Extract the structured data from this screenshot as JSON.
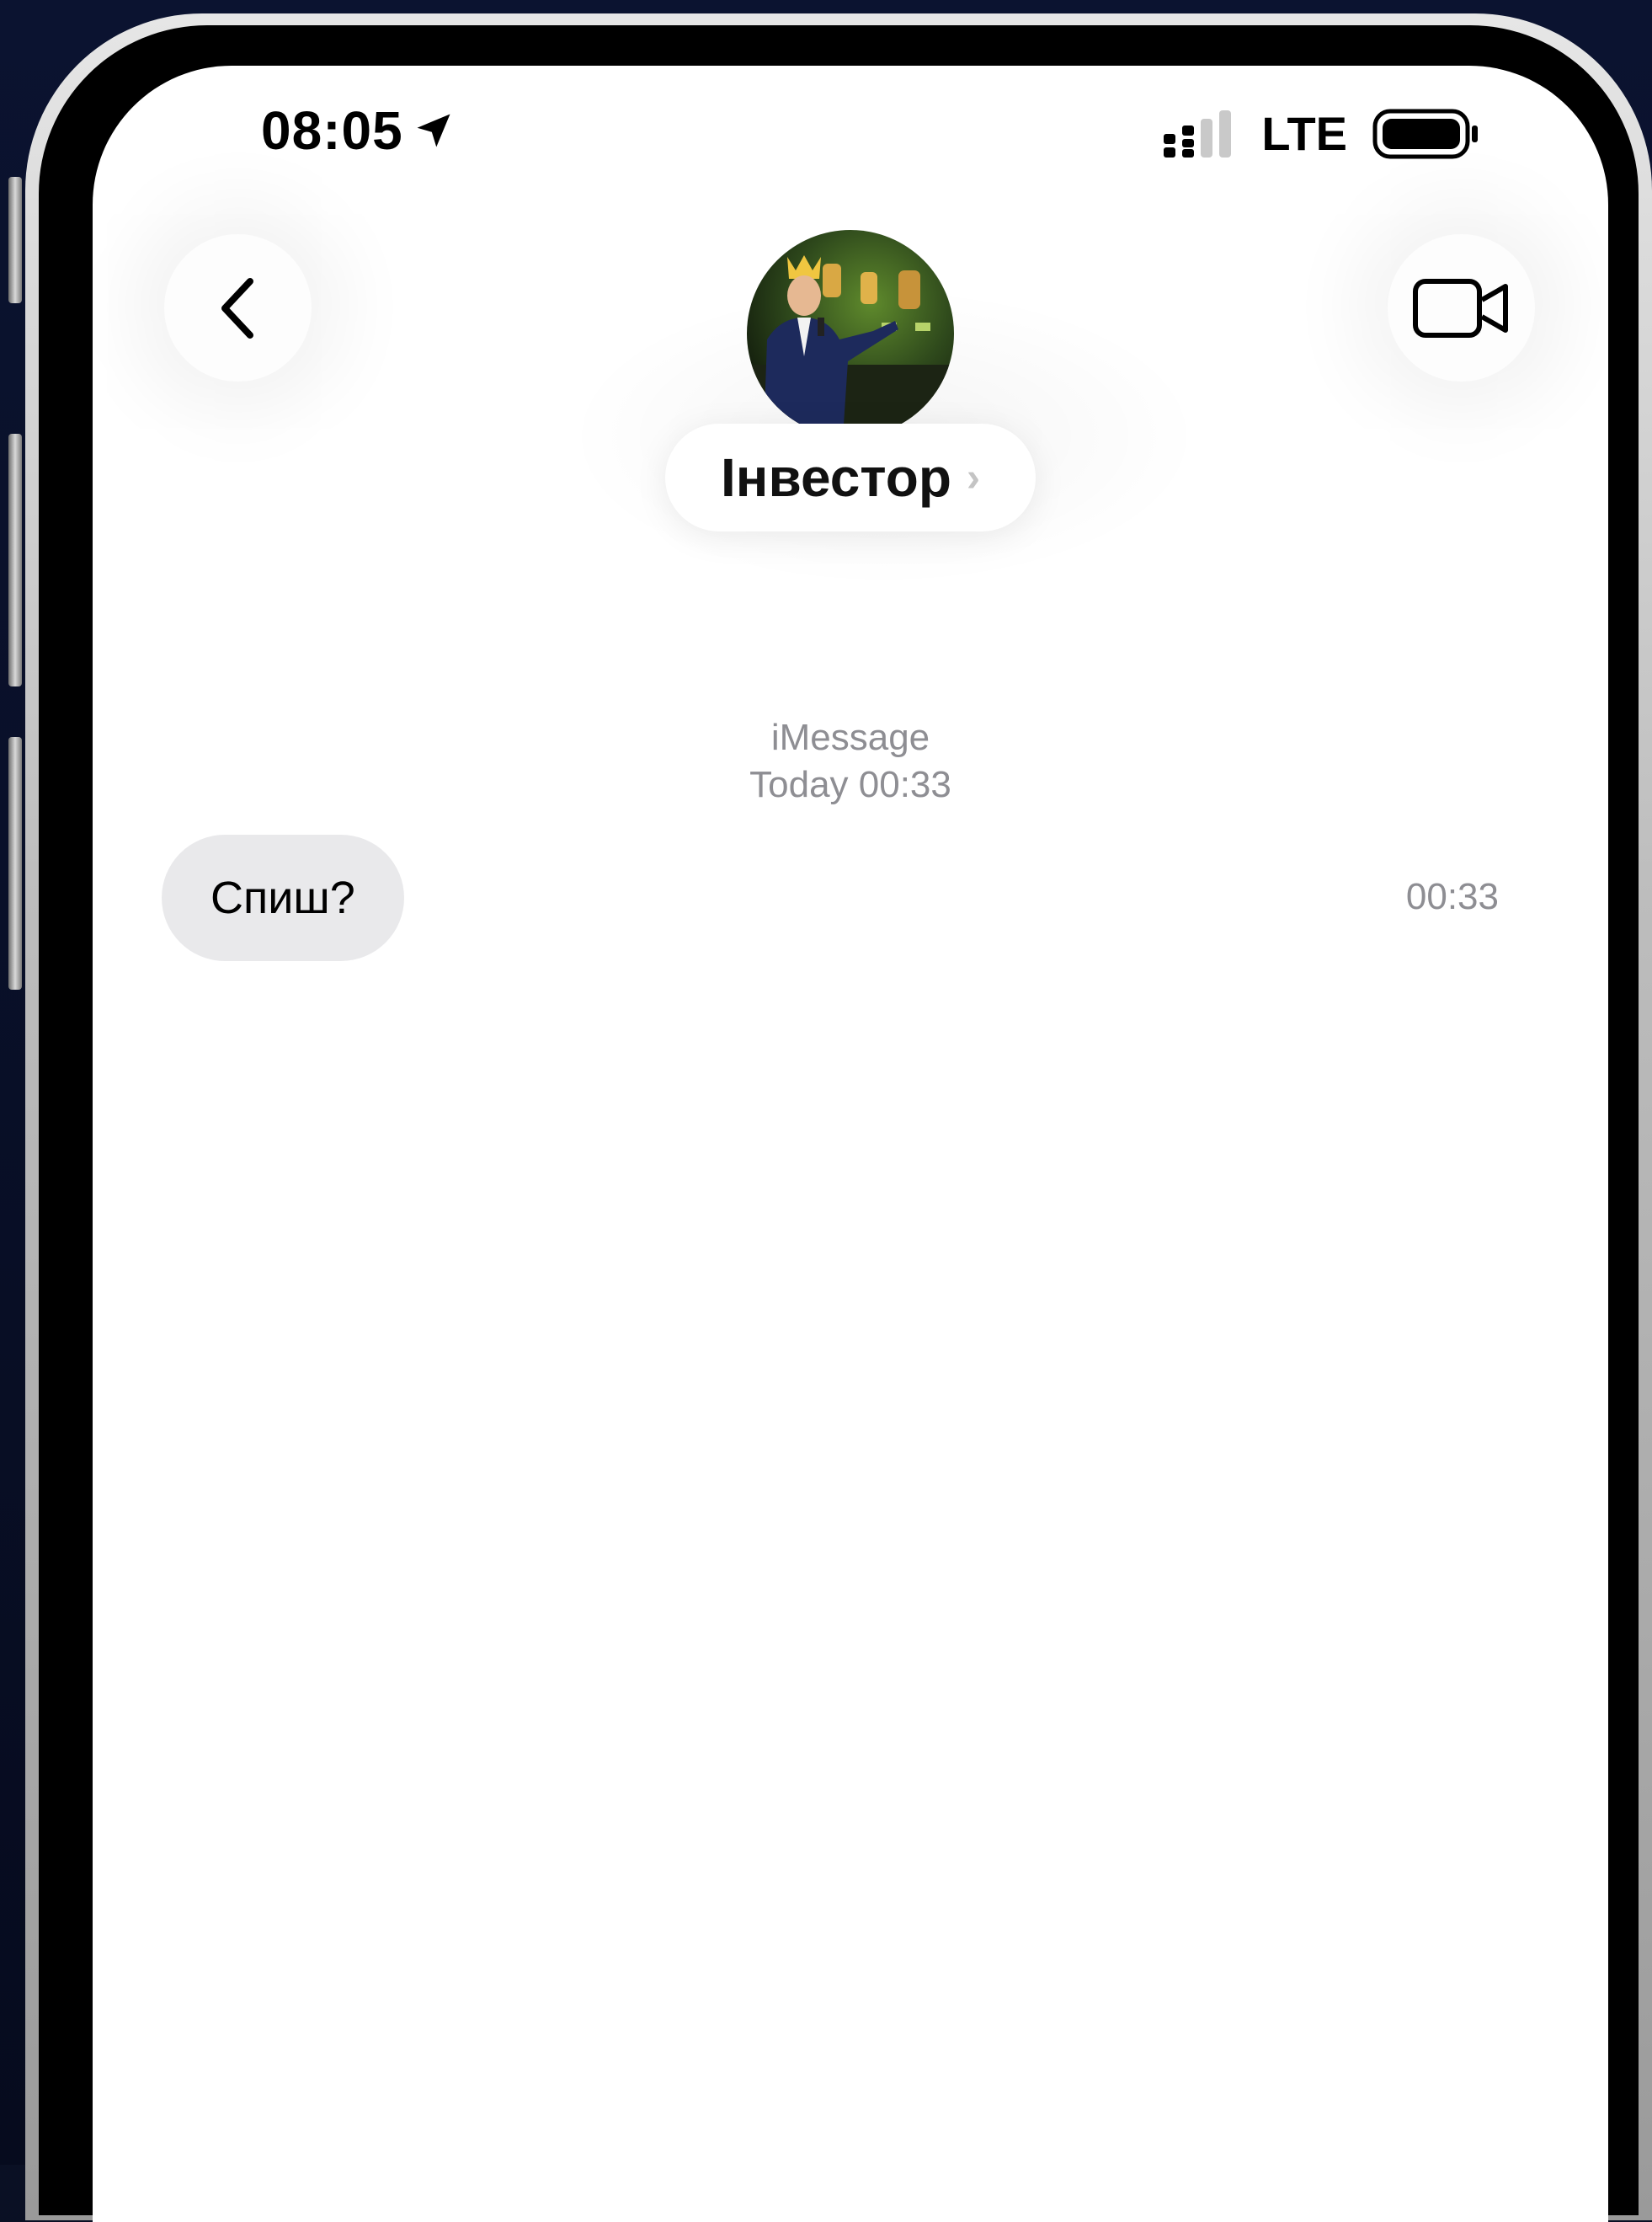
{
  "status_bar": {
    "time": "08:05",
    "network": "LTE",
    "location_icon": "location-arrow-icon",
    "signal_icon": "signal-icon",
    "battery_icon": "battery-icon"
  },
  "header": {
    "back_icon": "chevron-left-icon",
    "contact_name": "Інвестор",
    "contact_chevron": "›",
    "video_icon": "video-camera-icon"
  },
  "conversation": {
    "service": "iMessage",
    "date": "Today 00:33",
    "messages": [
      {
        "direction": "incoming",
        "text": "Спиш?",
        "time": "00:33"
      }
    ]
  },
  "colors": {
    "bubble_incoming": "#e9e9eb",
    "meta_text": "#8e8e93",
    "background": "#ffffff"
  }
}
